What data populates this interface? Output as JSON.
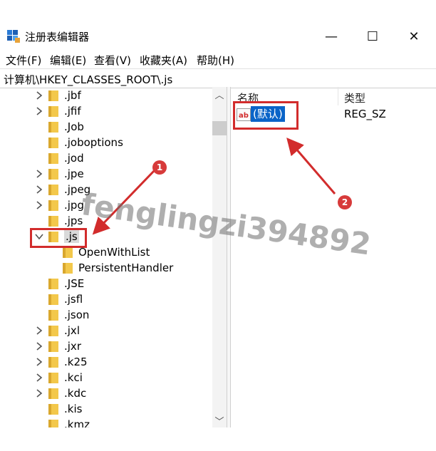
{
  "window": {
    "title": "注册表编辑器",
    "minimize_glyph": "—",
    "maximize_glyph": "☐",
    "close_glyph": "✕"
  },
  "menu": [
    "文件(F)",
    "编辑(E)",
    "查看(V)",
    "收藏夹(A)",
    "帮助(H)"
  ],
  "address": "计算机\\HKEY_CLASSES_ROOT\\.js",
  "tree": [
    {
      "label": ".jbf",
      "depth": 0,
      "state": "collapsed"
    },
    {
      "label": ".jfif",
      "depth": 0,
      "state": "collapsed"
    },
    {
      "label": ".Job",
      "depth": 0,
      "state": "none"
    },
    {
      "label": ".joboptions",
      "depth": 0,
      "state": "none"
    },
    {
      "label": ".jod",
      "depth": 0,
      "state": "none"
    },
    {
      "label": ".jpe",
      "depth": 0,
      "state": "collapsed"
    },
    {
      "label": ".jpeg",
      "depth": 0,
      "state": "collapsed"
    },
    {
      "label": ".jpg",
      "depth": 0,
      "state": "collapsed"
    },
    {
      "label": ".jps",
      "depth": 0,
      "state": "none"
    },
    {
      "label": ".js",
      "depth": 0,
      "state": "expanded",
      "selected": true
    },
    {
      "label": "OpenWithList",
      "depth": 1,
      "state": "none"
    },
    {
      "label": "PersistentHandler",
      "depth": 1,
      "state": "none"
    },
    {
      "label": ".JSE",
      "depth": 0,
      "state": "none"
    },
    {
      "label": ".jsfl",
      "depth": 0,
      "state": "none"
    },
    {
      "label": ".json",
      "depth": 0,
      "state": "none"
    },
    {
      "label": ".jxl",
      "depth": 0,
      "state": "collapsed"
    },
    {
      "label": ".jxr",
      "depth": 0,
      "state": "collapsed"
    },
    {
      "label": ".k25",
      "depth": 0,
      "state": "collapsed"
    },
    {
      "label": ".kci",
      "depth": 0,
      "state": "collapsed"
    },
    {
      "label": ".kdc",
      "depth": 0,
      "state": "collapsed"
    },
    {
      "label": ".kis",
      "depth": 0,
      "state": "none"
    },
    {
      "label": ".kmz",
      "depth": 0,
      "state": "none"
    }
  ],
  "list": {
    "col_name": "名称",
    "col_type": "类型",
    "rows": [
      {
        "icon": "ab-string-icon",
        "icon_text": "ab",
        "name": "(默认)",
        "type": "REG_SZ"
      }
    ]
  },
  "annotations": {
    "badge_1": "1",
    "badge_2": "2",
    "watermark": "fenglingzi394892"
  },
  "colors": {
    "annotation_red": "#d22c2c",
    "selection_blue": "#0a64c8",
    "folder_yellow": "#f3c84b"
  }
}
